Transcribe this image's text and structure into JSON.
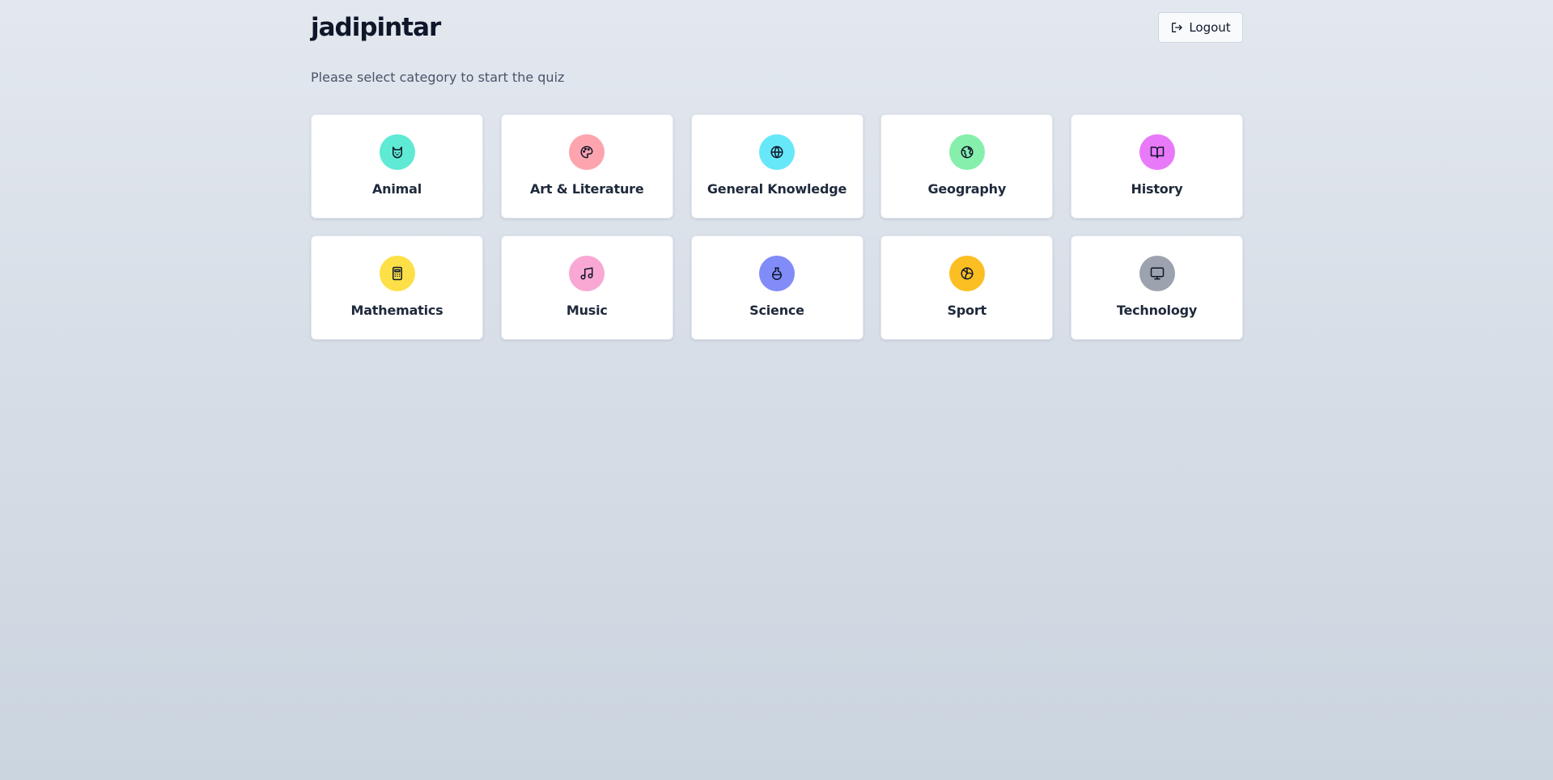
{
  "header": {
    "brand": "jadipintar",
    "logout_label": "Logout",
    "logout_icon": "logout-icon"
  },
  "subtitle": "Please select category to start the quiz",
  "categories": [
    {
      "label": "Animal",
      "icon": "cat-icon",
      "color": "#5eead4"
    },
    {
      "label": "Art & Literature",
      "icon": "palette-icon",
      "color": "#fda4af"
    },
    {
      "label": "General Knowledge",
      "icon": "globe-icon",
      "color": "#67e8f9"
    },
    {
      "label": "Geography",
      "icon": "earth-icon",
      "color": "#86efac"
    },
    {
      "label": "History",
      "icon": "book-open-icon",
      "color": "#e879f9"
    },
    {
      "label": "Mathematics",
      "icon": "calculator-icon",
      "color": "#fde047"
    },
    {
      "label": "Music",
      "icon": "music-note-icon",
      "color": "#f9a8d4"
    },
    {
      "label": "Science",
      "icon": "flask-icon",
      "color": "#818cf8"
    },
    {
      "label": "Sport",
      "icon": "volleyball-icon",
      "color": "#fbbf24"
    },
    {
      "label": "Technology",
      "icon": "monitor-icon",
      "color": "#9ca3af"
    }
  ]
}
